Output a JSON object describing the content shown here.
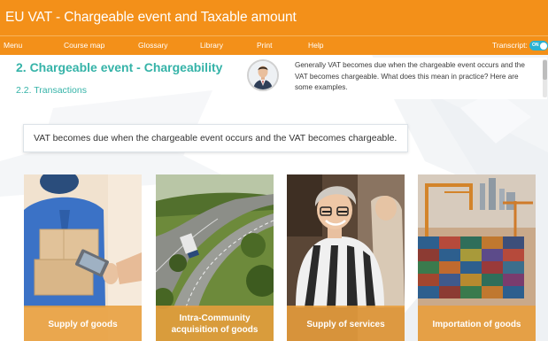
{
  "app": {
    "title": "EU VAT - Chargeable event and Taxable amount"
  },
  "menu": {
    "items": [
      {
        "label": "Menu"
      },
      {
        "label": "Course map"
      },
      {
        "label": "Glossary"
      },
      {
        "label": "Library"
      },
      {
        "label": "Print"
      },
      {
        "label": "Help"
      }
    ],
    "transcript_label": "Transcript:",
    "transcript_state": "ON"
  },
  "section": {
    "title": "2. Chargeable event - Chargeability",
    "subtitle": "2.2. Transactions"
  },
  "transcript": {
    "text": "Generally VAT becomes due when the chargeable event occurs and the VAT becomes chargeable. What does this mean in practice? Here are some examples."
  },
  "statement": {
    "text": "VAT becomes due when the chargeable event occurs and the VAT becomes chargeable."
  },
  "cards": [
    {
      "label": "Supply of goods",
      "image": "delivery-person-photo"
    },
    {
      "label": "Intra-Community acquisition of goods",
      "image": "highway-truck-photo"
    },
    {
      "label": "Supply of services",
      "image": "bartender-photo"
    },
    {
      "label": "Importation of goods",
      "image": "container-port-photo"
    }
  ],
  "colors": {
    "accent_orange": "#f39019",
    "teal": "#35b3a8",
    "toggle_blue": "#29b2d3"
  }
}
